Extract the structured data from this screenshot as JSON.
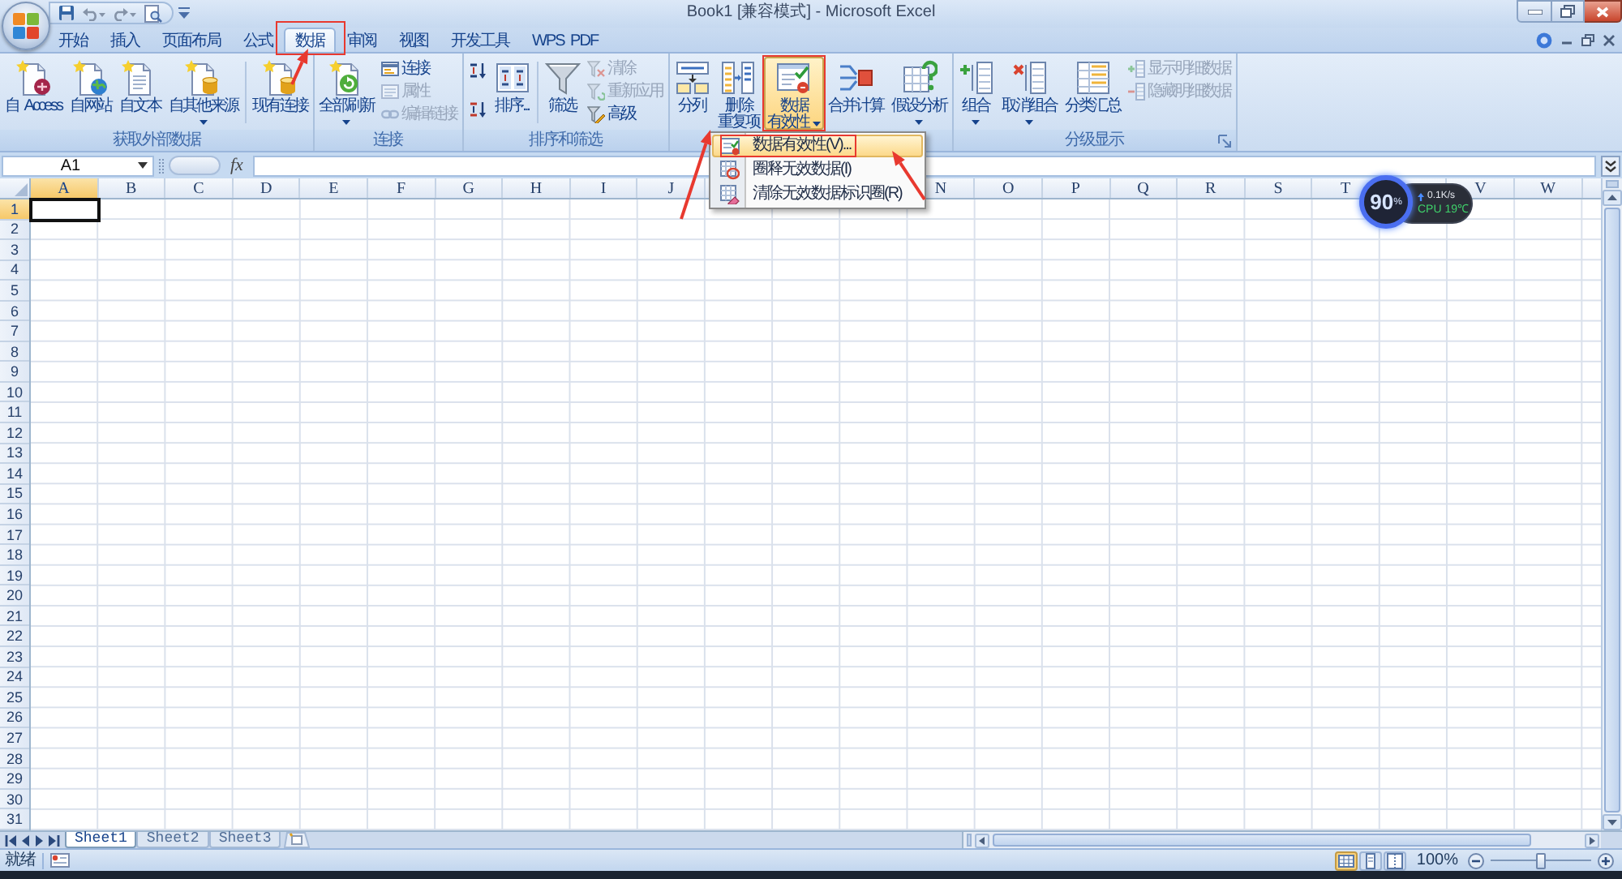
{
  "title_bar": {
    "title": "Book1 [兼容模式] - Microsoft Excel"
  },
  "ribbon_tabs": [
    {
      "label": "开始",
      "selected": false
    },
    {
      "label": "插入",
      "selected": false
    },
    {
      "label": "页面布局",
      "selected": false
    },
    {
      "label": "公式",
      "selected": false
    },
    {
      "label": "数据",
      "selected": true
    },
    {
      "label": "审阅",
      "selected": false
    },
    {
      "label": "视图",
      "selected": false
    },
    {
      "label": "开发工具",
      "selected": false
    },
    {
      "label": "WPS PDF",
      "selected": false
    }
  ],
  "ribbon_groups": [
    {
      "label": "获取外部数据",
      "dialog_launcher": false,
      "items": [
        {
          "kind": "large",
          "lines": [
            "自 Access"
          ],
          "dropdown": false,
          "pressed": false
        },
        {
          "kind": "large",
          "lines": [
            "自网站"
          ],
          "dropdown": false,
          "pressed": false
        },
        {
          "kind": "large",
          "lines": [
            "自文本"
          ],
          "dropdown": false,
          "pressed": false
        },
        {
          "kind": "large",
          "lines": [
            "自其他来源"
          ],
          "dropdown": true,
          "pressed": false
        },
        {
          "kind": "separator"
        },
        {
          "kind": "large",
          "lines": [
            "现有连接"
          ],
          "dropdown": false,
          "pressed": false
        }
      ]
    },
    {
      "label": "连接",
      "dialog_launcher": false,
      "items": [
        {
          "kind": "large",
          "lines": [
            "全部刷新"
          ],
          "dropdown": true,
          "pressed": false
        },
        {
          "kind": "stack",
          "items": [
            {
              "label": "连接",
              "disabled": false
            },
            {
              "label": "属性",
              "disabled": true
            },
            {
              "label": "编辑链接",
              "disabled": true
            }
          ]
        }
      ]
    },
    {
      "label": "排序和筛选",
      "dialog_launcher": false,
      "items": [
        {
          "kind": "icon_stack",
          "items": [
            {
              "disabled": false
            },
            {
              "disabled": false
            }
          ]
        },
        {
          "kind": "large",
          "lines": [
            "排序..."
          ],
          "dropdown": false,
          "pressed": false
        },
        {
          "kind": "separator"
        },
        {
          "kind": "large",
          "lines": [
            "筛选"
          ],
          "dropdown": false,
          "pressed": false
        },
        {
          "kind": "stack",
          "items": [
            {
              "label": "清除",
              "disabled": true
            },
            {
              "label": "重新应用",
              "disabled": true
            },
            {
              "label": "高级",
              "disabled": false
            }
          ]
        }
      ]
    },
    {
      "dialog_launcher": false,
      "items": [
        {
          "kind": "large",
          "lines": [
            "分列"
          ],
          "dropdown": false,
          "pressed": false
        },
        {
          "kind": "large",
          "lines": [
            "删除",
            "重复项"
          ],
          "dropdown": false,
          "pressed": false
        },
        {
          "kind": "large",
          "lines": [
            "数据",
            "有效性"
          ],
          "dropdown": true,
          "pressed": true,
          "menu": {
            "items": [
              {
                "label": "数据有效性(V)...",
                "selected": true
              },
              {
                "label": "圈释无效数据(I)",
                "selected": false
              },
              {
                "label": "清除无效数据标识圈(R)",
                "selected": false
              }
            ]
          }
        },
        {
          "kind": "large",
          "lines": [
            "合并计算"
          ],
          "dropdown": false,
          "pressed": false
        },
        {
          "kind": "large",
          "lines": [
            "假设分析"
          ],
          "dropdown": true,
          "pressed": false
        }
      ]
    },
    {
      "label": "分级显示",
      "dialog_launcher": true,
      "items": [
        {
          "kind": "large",
          "lines": [
            "组合"
          ],
          "dropdown": true,
          "pressed": false
        },
        {
          "kind": "large",
          "lines": [
            "取消组合"
          ],
          "dropdown": true,
          "pressed": false
        },
        {
          "kind": "large",
          "lines": [
            "分类汇总"
          ],
          "dropdown": false,
          "pressed": false
        },
        {
          "kind": "stack",
          "items": [
            {
              "label": "显示明细数据",
              "disabled": true
            },
            {
              "label": "隐藏明细数据",
              "disabled": true
            }
          ]
        }
      ]
    }
  ],
  "formula_bar": {
    "name_box": "A1",
    "function_button": "fx"
  },
  "column_headers": [
    [
      {
        "label": "A",
        "selected": true
      },
      {
        "label": "B",
        "selected": false
      },
      {
        "label": "C",
        "selected": false
      },
      {
        "label": "D",
        "selected": false
      },
      {
        "label": "E",
        "selected": false
      },
      {
        "label": "F",
        "selected": false
      },
      {
        "label": "G",
        "selected": false
      },
      {
        "label": "H",
        "selected": false
      },
      {
        "label": "I",
        "selected": false
      },
      {
        "label": "J",
        "selected": false
      }
    ],
    [
      {
        "label": "N",
        "selected": false
      },
      {
        "label": "O",
        "selected": false
      },
      {
        "label": "P",
        "selected": false
      },
      {
        "label": "Q",
        "selected": false
      },
      {
        "label": "R",
        "selected": false
      },
      {
        "label": "S",
        "selected": false
      },
      {
        "label": "T",
        "selected": false
      }
    ],
    [
      {
        "label": "V",
        "selected": false
      },
      {
        "label": "W",
        "selected": false
      }
    ]
  ],
  "row_headers": [
    {
      "label": "1",
      "selected": true
    },
    {
      "label": "2",
      "selected": false
    },
    {
      "label": "3",
      "selected": false
    },
    {
      "label": "4",
      "selected": false
    },
    {
      "label": "5",
      "selected": false
    },
    {
      "label": "6",
      "selected": false
    },
    {
      "label": "7",
      "selected": false
    },
    {
      "label": "8",
      "selected": false
    },
    {
      "label": "9",
      "selected": false
    },
    {
      "label": "10",
      "selected": false
    },
    {
      "label": "11",
      "selected": false
    },
    {
      "label": "12",
      "selected": false
    },
    {
      "label": "13",
      "selected": false
    },
    {
      "label": "14",
      "selected": false
    },
    {
      "label": "15",
      "selected": false
    },
    {
      "label": "16",
      "selected": false
    },
    {
      "label": "17",
      "selected": false
    },
    {
      "label": "18",
      "selected": false
    },
    {
      "label": "19",
      "selected": false
    },
    {
      "label": "20",
      "selected": false
    },
    {
      "label": "21",
      "selected": false
    },
    {
      "label": "22",
      "selected": false
    },
    {
      "label": "23",
      "selected": false
    },
    {
      "label": "24",
      "selected": false
    },
    {
      "label": "25",
      "selected": false
    },
    {
      "label": "26",
      "selected": false
    },
    {
      "label": "27",
      "selected": false
    },
    {
      "label": "28",
      "selected": false
    },
    {
      "label": "29",
      "selected": false
    },
    {
      "label": "30",
      "selected": false
    },
    {
      "label": "31",
      "selected": false
    }
  ],
  "sheet_tabs": [
    {
      "label": "Sheet1",
      "selected": true
    },
    {
      "label": "Sheet2",
      "selected": false
    },
    {
      "label": "Sheet3",
      "selected": false
    }
  ],
  "status_bar": {
    "status": "就绪",
    "view_buttons": [
      {
        "selected": true
      },
      {
        "selected": false
      },
      {
        "selected": false
      }
    ],
    "zoom": "100%",
    "zoom_slider": {
      "level": 0.5
    }
  },
  "monitor_widget": {
    "value": "90",
    "unit": "%",
    "speed": "0.1K/s",
    "temperature": "CPU 19℃"
  }
}
